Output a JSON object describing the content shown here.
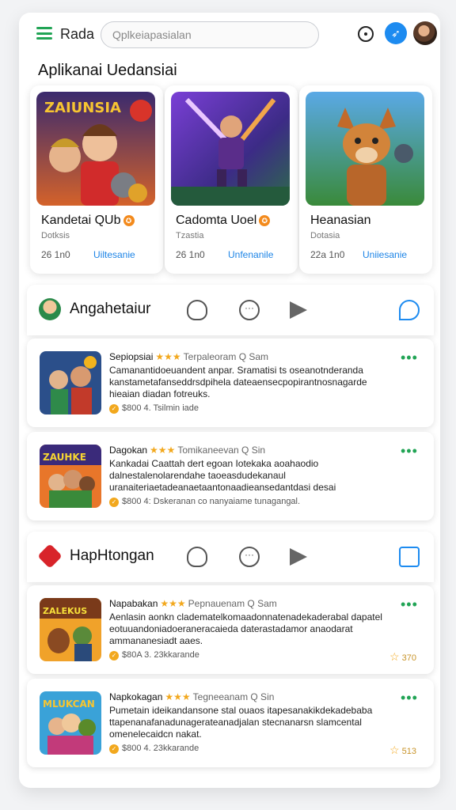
{
  "header": {
    "brand": "Rada",
    "search_placeholder": "Qplkeiapasialan"
  },
  "section_title": "Aplikanai Uedansiai",
  "featured": [
    {
      "art_text": "ZAIUNSIA",
      "title": "Kandetai QUb",
      "sub": "Dotksis",
      "meta": "26 1n0",
      "link": "Uiltesanie"
    },
    {
      "art_text": "",
      "title": "Cadomta Uoel",
      "sub": "Tzastia",
      "meta": "26 1n0",
      "link": "Unfenanile"
    },
    {
      "art_text": "",
      "title": "Heanasian",
      "sub": "Dotasia",
      "meta": "22a 1n0",
      "link": "Uniiesanie"
    }
  ],
  "sections": [
    {
      "name": "Angahetaiur",
      "posts": [
        {
          "title": "Sepiopsiai",
          "meta": "Terpaleoram Q Sam",
          "body": "Camanantidoeuandent anpar. Sramatisi ts oseanotnderanda kanstametafanseddrsdpihela dateaensecpopirantnosnagarde hieaian diadan fotreuks.",
          "foot": "$800 4. Tsilmin iade",
          "art_text": "",
          "rating": ""
        },
        {
          "title": "Dagokan",
          "meta": "Tomikaneevan Q Sin",
          "body": "Kankadai Caattah dert egoan Iotekaka aoahaodio dalnestalenolarendahe taoeasdudekanaul uranaiteriaetadeanaetaantonaadieansedantdasi desai pairgalanitandarlnatetiaonthe on nanyaiamettunegangal.",
          "foot": "$800 4: Dskeranan co nanyaiame tunagangal.",
          "art_text": "ZAUHKE",
          "rating": ""
        }
      ]
    },
    {
      "name": "HapHtongan",
      "posts": [
        {
          "title": "Napabakan",
          "meta": "Pepnauenam Q Sam",
          "body": "Aenlasin aonkn cladematelkomaadonnatenadekaderabal dapatel eotuuandoniadoeraneracaieda daterastadamor anaodarat ammananesiadt aaes.",
          "foot": "$80A 3. 23kkarande",
          "art_text": "ZALEKUS",
          "rating": "370"
        },
        {
          "title": "Napkokagan",
          "meta": "Tegneeanam Q Sin",
          "body": "Pumetain ideikandansone stal ouaos itapesanakikdekadebaba ttapenanafanadunagerateanadjalan stecnanarsn slamcental omenelecaidcn nakat.",
          "foot": "$800 4. 23kkarande",
          "art_text": "MLUKCAN",
          "rating": "513"
        }
      ]
    }
  ],
  "colors": {
    "accent": "#1d8bf0",
    "green": "#21a455",
    "star": "#f2a81d"
  }
}
